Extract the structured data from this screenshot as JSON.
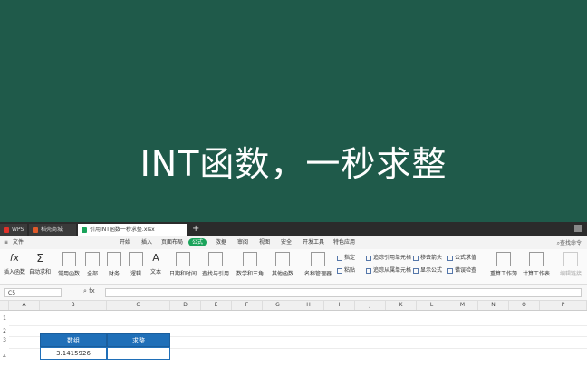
{
  "banner": {
    "title": "INT函数，一秒求整"
  },
  "tabs": {
    "wps": "WPS",
    "mall": "稻壳商城",
    "doc": "引用INT函数一秒求整.xlsx",
    "new_tab": "+"
  },
  "menu": {
    "file": "文件",
    "items": [
      "开始",
      "插入",
      "页面布局",
      "公式",
      "数据",
      "审阅",
      "视图",
      "安全",
      "开发工具",
      "特色应用"
    ],
    "active_index": 3,
    "search": "查找命令"
  },
  "ribbon": {
    "buttons": [
      "插入函数",
      "自动求和",
      "常用函数",
      "全部",
      "财务",
      "逻辑",
      "文本",
      "日期和时间",
      "查找与引用",
      "数学和三角",
      "其他函数",
      "名称管理器"
    ],
    "small": [
      "指定",
      "粘贴",
      "追踪引用单元格",
      "追踪从属单元格",
      "移去箭头",
      "显示公式",
      "公式求值",
      "错误检查",
      "重算工作簿",
      "计算工作表",
      "编辑链接"
    ]
  },
  "formula_bar": {
    "name_box": "C5",
    "fx": "fx"
  },
  "columns": [
    "A",
    "B",
    "C",
    "D",
    "E",
    "F",
    "G",
    "H",
    "I",
    "J",
    "K",
    "L",
    "M",
    "N",
    "O",
    "P"
  ],
  "rows": [
    "1",
    "2",
    "3",
    "4"
  ],
  "table": {
    "header": [
      "数组",
      "求整"
    ],
    "rows": [
      [
        "3.1415926",
        ""
      ]
    ]
  },
  "colors": {
    "banner": "#1f5a4a",
    "accent": "#1aa35a",
    "table_header": "#1f6fb8"
  }
}
